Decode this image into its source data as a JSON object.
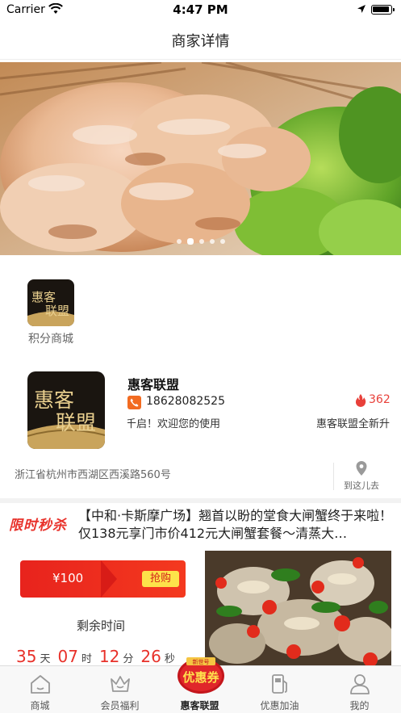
{
  "status_bar": {
    "carrier": "Carrier",
    "time": "4:47 PM"
  },
  "nav": {
    "title": "商家详情"
  },
  "banner": {
    "slides": 5,
    "active_index": 1
  },
  "shortcut": {
    "label": "积分商城",
    "logo_text_line1": "惠客",
    "logo_text_line2": "联盟"
  },
  "shop": {
    "name": "惠客联盟",
    "phone": "18628082525",
    "hot_count": "362",
    "marquee_left": "千启！欢迎您的使用",
    "marquee_right": "惠客联盟全新升",
    "logo_text_line1": "惠客",
    "logo_text_line2": "联盟",
    "address": "浙江省杭州市西湖区西溪路560号",
    "goto_label": "到这儿去"
  },
  "flash_sale": {
    "tag": "限时秒杀",
    "title": "【中和·卡斯摩广场】翘首以盼的堂食大闸蟹终于来啦！仅138元享门市价412元大闸蟹套餐～清蒸大…",
    "price": "¥100",
    "grab_label": "抢购",
    "remain_label": "剩余时间",
    "countdown": {
      "days": "35",
      "days_unit": "天",
      "hours": "07",
      "hours_unit": "时",
      "minutes": "12",
      "minutes_unit": "分",
      "seconds": "26",
      "seconds_unit": "秒"
    }
  },
  "center_badge": {
    "small_text": "新世号",
    "big_text": "优惠券"
  },
  "tabs": [
    {
      "label": "商城",
      "icon": "home-icon"
    },
    {
      "label": "会员福利",
      "icon": "crown-icon"
    },
    {
      "label": "惠客联盟",
      "icon": "coupon-badge-icon",
      "active": true
    },
    {
      "label": "优惠加油",
      "icon": "fuel-pump-icon"
    },
    {
      "label": "我的",
      "icon": "user-icon"
    }
  ],
  "colors": {
    "accent": "#e8312a",
    "phone_icon": "#f26b21",
    "grab_button": "#fde24a",
    "tab_bar": "#f8f8f8"
  }
}
